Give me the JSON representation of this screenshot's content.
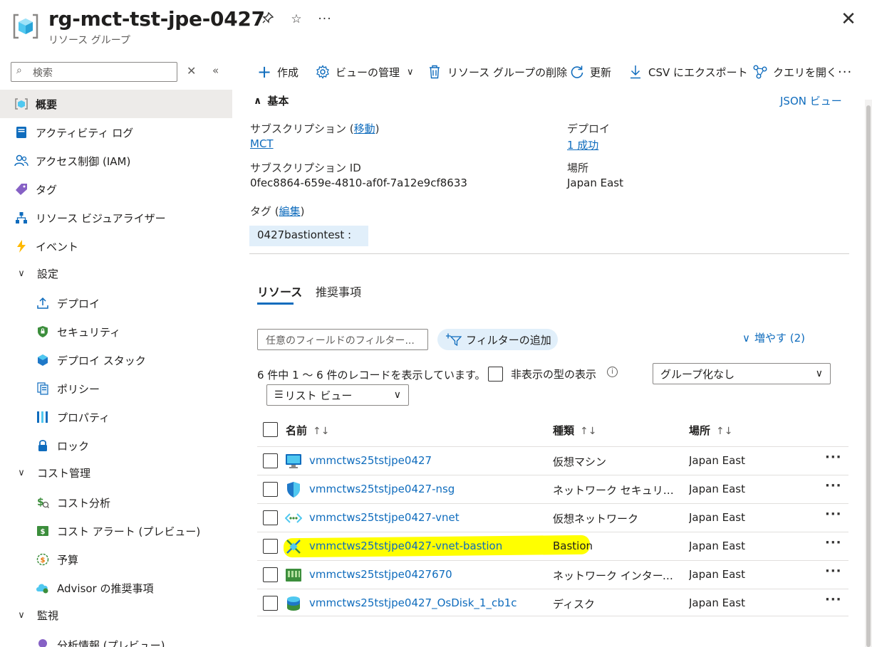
{
  "header": {
    "title": "rg-mct-tst-jpe-0427",
    "subtitle": "リソース グループ"
  },
  "sidebar": {
    "search_placeholder": "検索",
    "items": [
      {
        "label": "概要"
      },
      {
        "label": "アクティビティ ログ"
      },
      {
        "label": "アクセス制御 (IAM)"
      },
      {
        "label": "タグ"
      },
      {
        "label": "リソース ビジュアライザー"
      },
      {
        "label": "イベント"
      }
    ],
    "groups": [
      {
        "label": "設定",
        "items": [
          {
            "label": "デプロイ"
          },
          {
            "label": "セキュリティ"
          },
          {
            "label": "デプロイ スタック"
          },
          {
            "label": "ポリシー"
          },
          {
            "label": "プロパティ"
          },
          {
            "label": "ロック"
          }
        ]
      },
      {
        "label": "コスト管理",
        "items": [
          {
            "label": "コスト分析"
          },
          {
            "label": "コスト アラート (プレビュー)"
          },
          {
            "label": "予算"
          },
          {
            "label": "Advisor の推奨事項"
          }
        ]
      },
      {
        "label": "監視",
        "items": [
          {
            "label": "分析情報 (プレビュー)"
          }
        ]
      }
    ]
  },
  "toolbar": {
    "create": "作成",
    "manage_view": "ビューの管理",
    "delete_rg": "リソース グループの削除",
    "refresh": "更新",
    "export_csv": "CSV にエクスポート",
    "open_query": "クエリを開く",
    "more": "···"
  },
  "essentials": {
    "section_title": "基本",
    "json_view": "JSON ビュー",
    "subscription_label": "サブスクリプション",
    "subscription_move": "移動",
    "subscription_value": "MCT",
    "subscription_id_label": "サブスクリプション ID",
    "subscription_id_value": "0fec8864-659e-4810-af0f-7a12e9cf8633",
    "deploy_label": "デプロイ",
    "deploy_value": "1 成功",
    "location_label": "場所",
    "location_value": "Japan East",
    "tags_label": "タグ",
    "tags_edit": "編集",
    "tag_chip": "0427bastiontest :"
  },
  "tabs": {
    "resources": "リソース",
    "recommendations": "推奨事項"
  },
  "filters": {
    "filter_placeholder": "任意のフィールドのフィルター...",
    "add_filter": "フィルターの追加",
    "expand_more": "増やす (2)",
    "record_count": "6 件中 1 ～ 6 件のレコードを表示しています。",
    "show_hidden": "非表示の型の表示",
    "grouping": "グループ化なし",
    "view_mode": "リスト ビュー"
  },
  "table": {
    "columns": {
      "name": "名前",
      "type": "種類",
      "location": "場所"
    },
    "rows": [
      {
        "name": "vmmctws25tstjpe0427",
        "type": "仮想マシン",
        "location": "Japan East",
        "icon": "virtual-machine-icon"
      },
      {
        "name": "vmmctws25tstjpe0427-nsg",
        "type": "ネットワーク セキュリティ グループ",
        "location": "Japan East",
        "icon": "nsg-shield-icon"
      },
      {
        "name": "vmmctws25tstjpe0427-vnet",
        "type": "仮想ネットワーク",
        "location": "Japan East",
        "icon": "vnet-icon"
      },
      {
        "name": "vmmctws25tstjpe0427-vnet-bastion",
        "type": "Bastion",
        "location": "Japan East",
        "icon": "bastion-icon",
        "highlighted": true
      },
      {
        "name": "vmmctws25tstjpe0427670",
        "type": "ネットワーク インターフェイス",
        "location": "Japan East",
        "icon": "network-interface-icon"
      },
      {
        "name": "vmmctws25tstjpe0427_OsDisk_1_cb1c",
        "type": "ディスク",
        "location": "Japan East",
        "icon": "disk-icon"
      }
    ]
  },
  "colors": {
    "accent": "#0f6cbd",
    "highlight": "#ffff00",
    "active_nav_bg": "#edebe9",
    "chip_bg": "#e1effa"
  }
}
